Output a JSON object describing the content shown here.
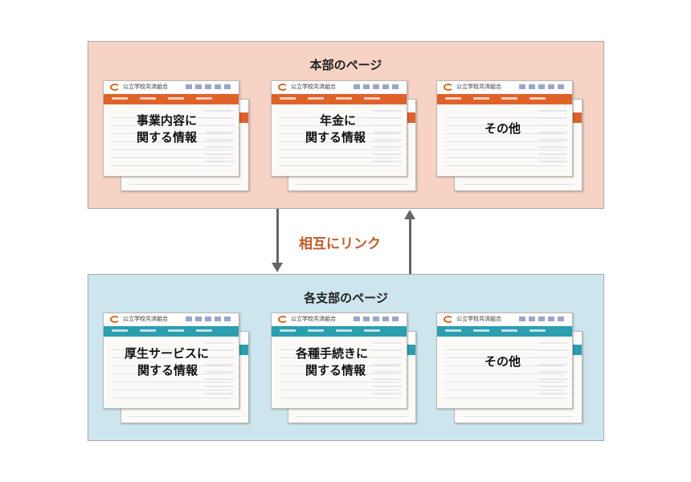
{
  "top_panel": {
    "title": "本部のページ",
    "pages": [
      {
        "label_1": "事業内容に",
        "label_2": "関する情報"
      },
      {
        "label_1": "年金に",
        "label_2": "関する情報"
      },
      {
        "label_1": "その他",
        "label_2": ""
      }
    ]
  },
  "bottom_panel": {
    "title": "各支部のページ",
    "pages": [
      {
        "label_1": "厚生サービスに",
        "label_2": "関する情報"
      },
      {
        "label_1": "各種手続きに",
        "label_2": "関する情報"
      },
      {
        "label_1": "その他",
        "label_2": ""
      }
    ]
  },
  "mutual_link": "相互にリンク",
  "thumbnail": {
    "org_name": "公立学校共済組合"
  },
  "colors": {
    "top_bg": "#f6d3c4",
    "bottom_bg": "#cde6ee",
    "orange_nav": "#e0622b",
    "teal_nav": "#2b9fb0",
    "accent_text": "#c45a2a"
  }
}
